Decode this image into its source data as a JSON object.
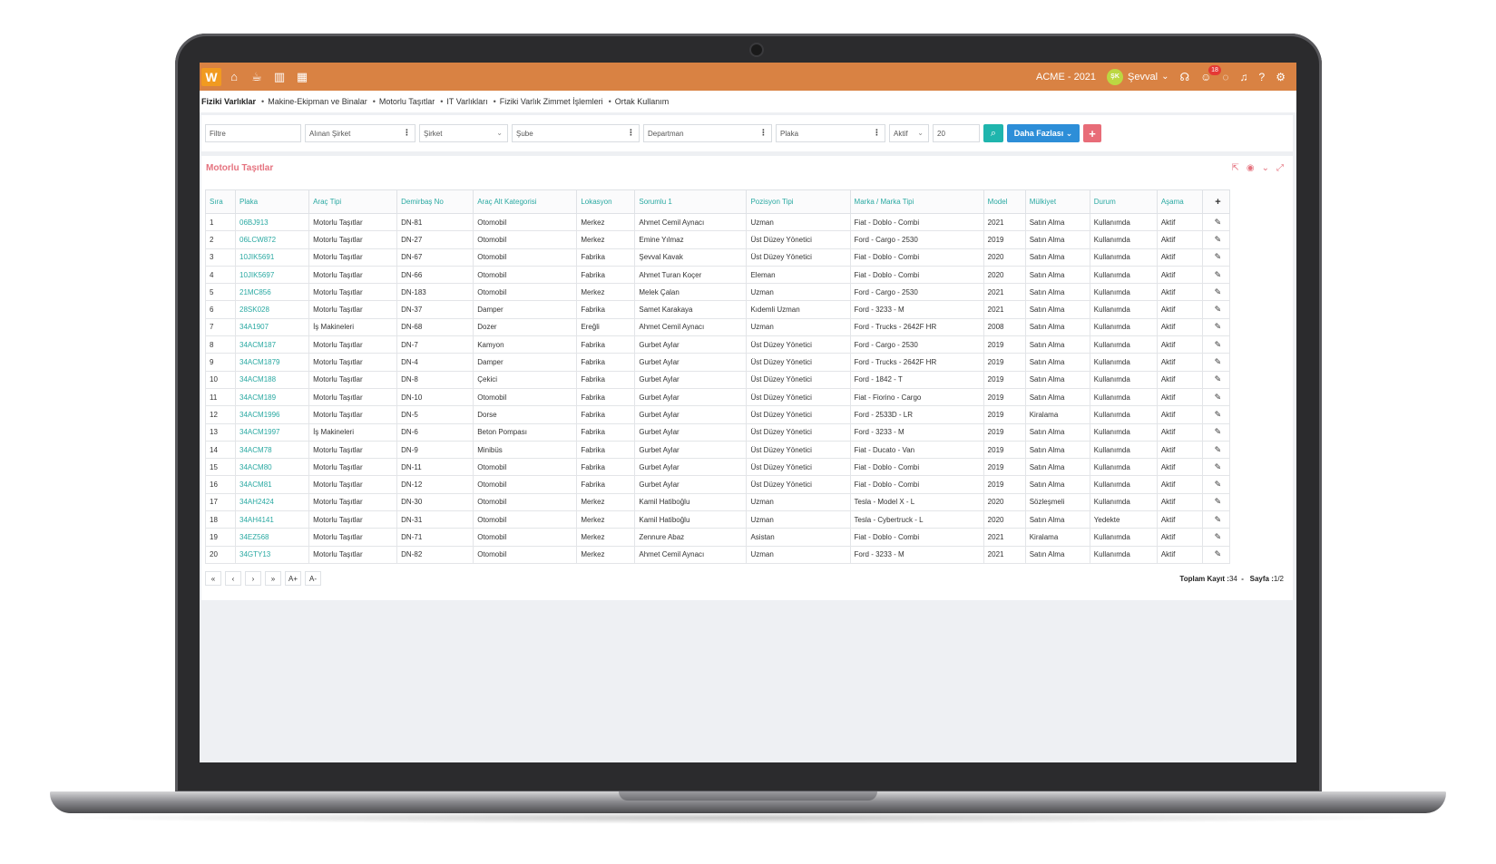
{
  "topbar": {
    "logo": "W",
    "company": "ACME - 2021",
    "user_initials": "ŞK",
    "user_name": "Şevval",
    "notification_count": "18"
  },
  "breadcrumb": [
    "Fiziki Varlıklar",
    "Makine-Ekipman ve Binalar",
    "Motorlu Taşıtlar",
    "IT Varlıkları",
    "Fiziki Varlık Zimmet İşlemleri",
    "Ortak Kullanım"
  ],
  "filters": {
    "filter_placeholder": "Filtre",
    "received_company": "Alınan Şirket",
    "company": "Şirket",
    "branch": "Şube",
    "department": "Departman",
    "plate": "Plaka",
    "status": "Aktif",
    "page_size": "20",
    "more_label": "Daha Fazlası"
  },
  "panel": {
    "title": "Motorlu Taşıtlar"
  },
  "table": {
    "headers": [
      "Sıra",
      "Plaka",
      "Araç Tipi",
      "Demirbaş No",
      "Araç Alt Kategorisi",
      "Lokasyon",
      "Sorumlu 1",
      "Pozisyon Tipi",
      "Marka / Marka Tipi",
      "Model",
      "Mülkiyet",
      "Durum",
      "Aşama"
    ],
    "rows": [
      [
        "1",
        "06BJ913",
        "Motorlu Taşıtlar",
        "DN-81",
        "Otomobil",
        "Merkez",
        "Ahmet Cemil Aynacı",
        "Uzman",
        "Fiat - Doblo - Combi",
        "2021",
        "Satın Alma",
        "Kullanımda",
        "Aktif"
      ],
      [
        "2",
        "06LCW872",
        "Motorlu Taşıtlar",
        "DN-27",
        "Otomobil",
        "Merkez",
        "Emine Yılmaz",
        "Üst Düzey Yönetici",
        "Ford - Cargo - 2530",
        "2019",
        "Satın Alma",
        "Kullanımda",
        "Aktif"
      ],
      [
        "3",
        "10JIK5691",
        "Motorlu Taşıtlar",
        "DN-67",
        "Otomobil",
        "Fabrika",
        "Şevval Kavak",
        "Üst Düzey Yönetici",
        "Fiat - Doblo - Combi",
        "2020",
        "Satın Alma",
        "Kullanımda",
        "Aktif"
      ],
      [
        "4",
        "10JIK5697",
        "Motorlu Taşıtlar",
        "DN-66",
        "Otomobil",
        "Fabrika",
        "Ahmet Turan Koçer",
        "Eleman",
        "Fiat - Doblo - Combi",
        "2020",
        "Satın Alma",
        "Kullanımda",
        "Aktif"
      ],
      [
        "5",
        "21MC856",
        "Motorlu Taşıtlar",
        "DN-183",
        "Otomobil",
        "Merkez",
        "Melek Çalan",
        "Uzman",
        "Ford - Cargo - 2530",
        "2021",
        "Satın Alma",
        "Kullanımda",
        "Aktif"
      ],
      [
        "6",
        "28SK028",
        "Motorlu Taşıtlar",
        "DN-37",
        "Damper",
        "Fabrika",
        "Samet Karakaya",
        "Kıdemli Uzman",
        "Ford - 3233 - M",
        "2021",
        "Satın Alma",
        "Kullanımda",
        "Aktif"
      ],
      [
        "7",
        "34A1907",
        "İş Makineleri",
        "DN-68",
        "Dozer",
        "Ereğli",
        "Ahmet Cemil Aynacı",
        "Uzman",
        "Ford - Trucks - 2642F HR",
        "2008",
        "Satın Alma",
        "Kullanımda",
        "Aktif"
      ],
      [
        "8",
        "34ACM187",
        "Motorlu Taşıtlar",
        "DN-7",
        "Kamyon",
        "Fabrika",
        "Gurbet Aylar",
        "Üst Düzey Yönetici",
        "Ford - Cargo - 2530",
        "2019",
        "Satın Alma",
        "Kullanımda",
        "Aktif"
      ],
      [
        "9",
        "34ACM1879",
        "Motorlu Taşıtlar",
        "DN-4",
        "Damper",
        "Fabrika",
        "Gurbet Aylar",
        "Üst Düzey Yönetici",
        "Ford - Trucks - 2642F HR",
        "2019",
        "Satın Alma",
        "Kullanımda",
        "Aktif"
      ],
      [
        "10",
        "34ACM188",
        "Motorlu Taşıtlar",
        "DN-8",
        "Çekici",
        "Fabrika",
        "Gurbet Aylar",
        "Üst Düzey Yönetici",
        "Ford - 1842 - T",
        "2019",
        "Satın Alma",
        "Kullanımda",
        "Aktif"
      ],
      [
        "11",
        "34ACM189",
        "Motorlu Taşıtlar",
        "DN-10",
        "Otomobil",
        "Fabrika",
        "Gurbet Aylar",
        "Üst Düzey Yönetici",
        "Fiat - Fiorino - Cargo",
        "2019",
        "Satın Alma",
        "Kullanımda",
        "Aktif"
      ],
      [
        "12",
        "34ACM1996",
        "Motorlu Taşıtlar",
        "DN-5",
        "Dorse",
        "Fabrika",
        "Gurbet Aylar",
        "Üst Düzey Yönetici",
        "Ford - 2533D - LR",
        "2019",
        "Kiralama",
        "Kullanımda",
        "Aktif"
      ],
      [
        "13",
        "34ACM1997",
        "İş Makineleri",
        "DN-6",
        "Beton Pompası",
        "Fabrika",
        "Gurbet Aylar",
        "Üst Düzey Yönetici",
        "Ford - 3233 - M",
        "2019",
        "Satın Alma",
        "Kullanımda",
        "Aktif"
      ],
      [
        "14",
        "34ACM78",
        "Motorlu Taşıtlar",
        "DN-9",
        "Minibüs",
        "Fabrika",
        "Gurbet Aylar",
        "Üst Düzey Yönetici",
        "Fiat - Ducato - Van",
        "2019",
        "Satın Alma",
        "Kullanımda",
        "Aktif"
      ],
      [
        "15",
        "34ACM80",
        "Motorlu Taşıtlar",
        "DN-11",
        "Otomobil",
        "Fabrika",
        "Gurbet Aylar",
        "Üst Düzey Yönetici",
        "Fiat - Doblo - Combi",
        "2019",
        "Satın Alma",
        "Kullanımda",
        "Aktif"
      ],
      [
        "16",
        "34ACM81",
        "Motorlu Taşıtlar",
        "DN-12",
        "Otomobil",
        "Fabrika",
        "Gurbet Aylar",
        "Üst Düzey Yönetici",
        "Fiat - Doblo - Combi",
        "2019",
        "Satın Alma",
        "Kullanımda",
        "Aktif"
      ],
      [
        "17",
        "34AH2424",
        "Motorlu Taşıtlar",
        "DN-30",
        "Otomobil",
        "Merkez",
        "Kamil Hatiboğlu",
        "Uzman",
        "Tesla - Model X - L",
        "2020",
        "Sözleşmeli",
        "Kullanımda",
        "Aktif"
      ],
      [
        "18",
        "34AH4141",
        "Motorlu Taşıtlar",
        "DN-31",
        "Otomobil",
        "Merkez",
        "Kamil Hatiboğlu",
        "Uzman",
        "Tesla - Cybertruck - L",
        "2020",
        "Satın Alma",
        "Yedekte",
        "Aktif"
      ],
      [
        "19",
        "34EZ568",
        "Motorlu Taşıtlar",
        "DN-71",
        "Otomobil",
        "Merkez",
        "Zennure Abaz",
        "Asistan",
        "Fiat - Doblo - Combi",
        "2021",
        "Kiralama",
        "Kullanımda",
        "Aktif"
      ],
      [
        "20",
        "34GTY13",
        "Motorlu Taşıtlar",
        "DN-82",
        "Otomobil",
        "Merkez",
        "Ahmet Cemil Aynacı",
        "Uzman",
        "Ford - 3233 - M",
        "2021",
        "Satın Alma",
        "Kullanımda",
        "Aktif"
      ]
    ]
  },
  "pager": {
    "buttons": [
      "«",
      "‹",
      "›",
      "»",
      "A+",
      "A-"
    ],
    "total_label": "Toplam Kayıt :",
    "total_value": "34",
    "page_label": "Sayfa :",
    "page_value": "1/2"
  }
}
